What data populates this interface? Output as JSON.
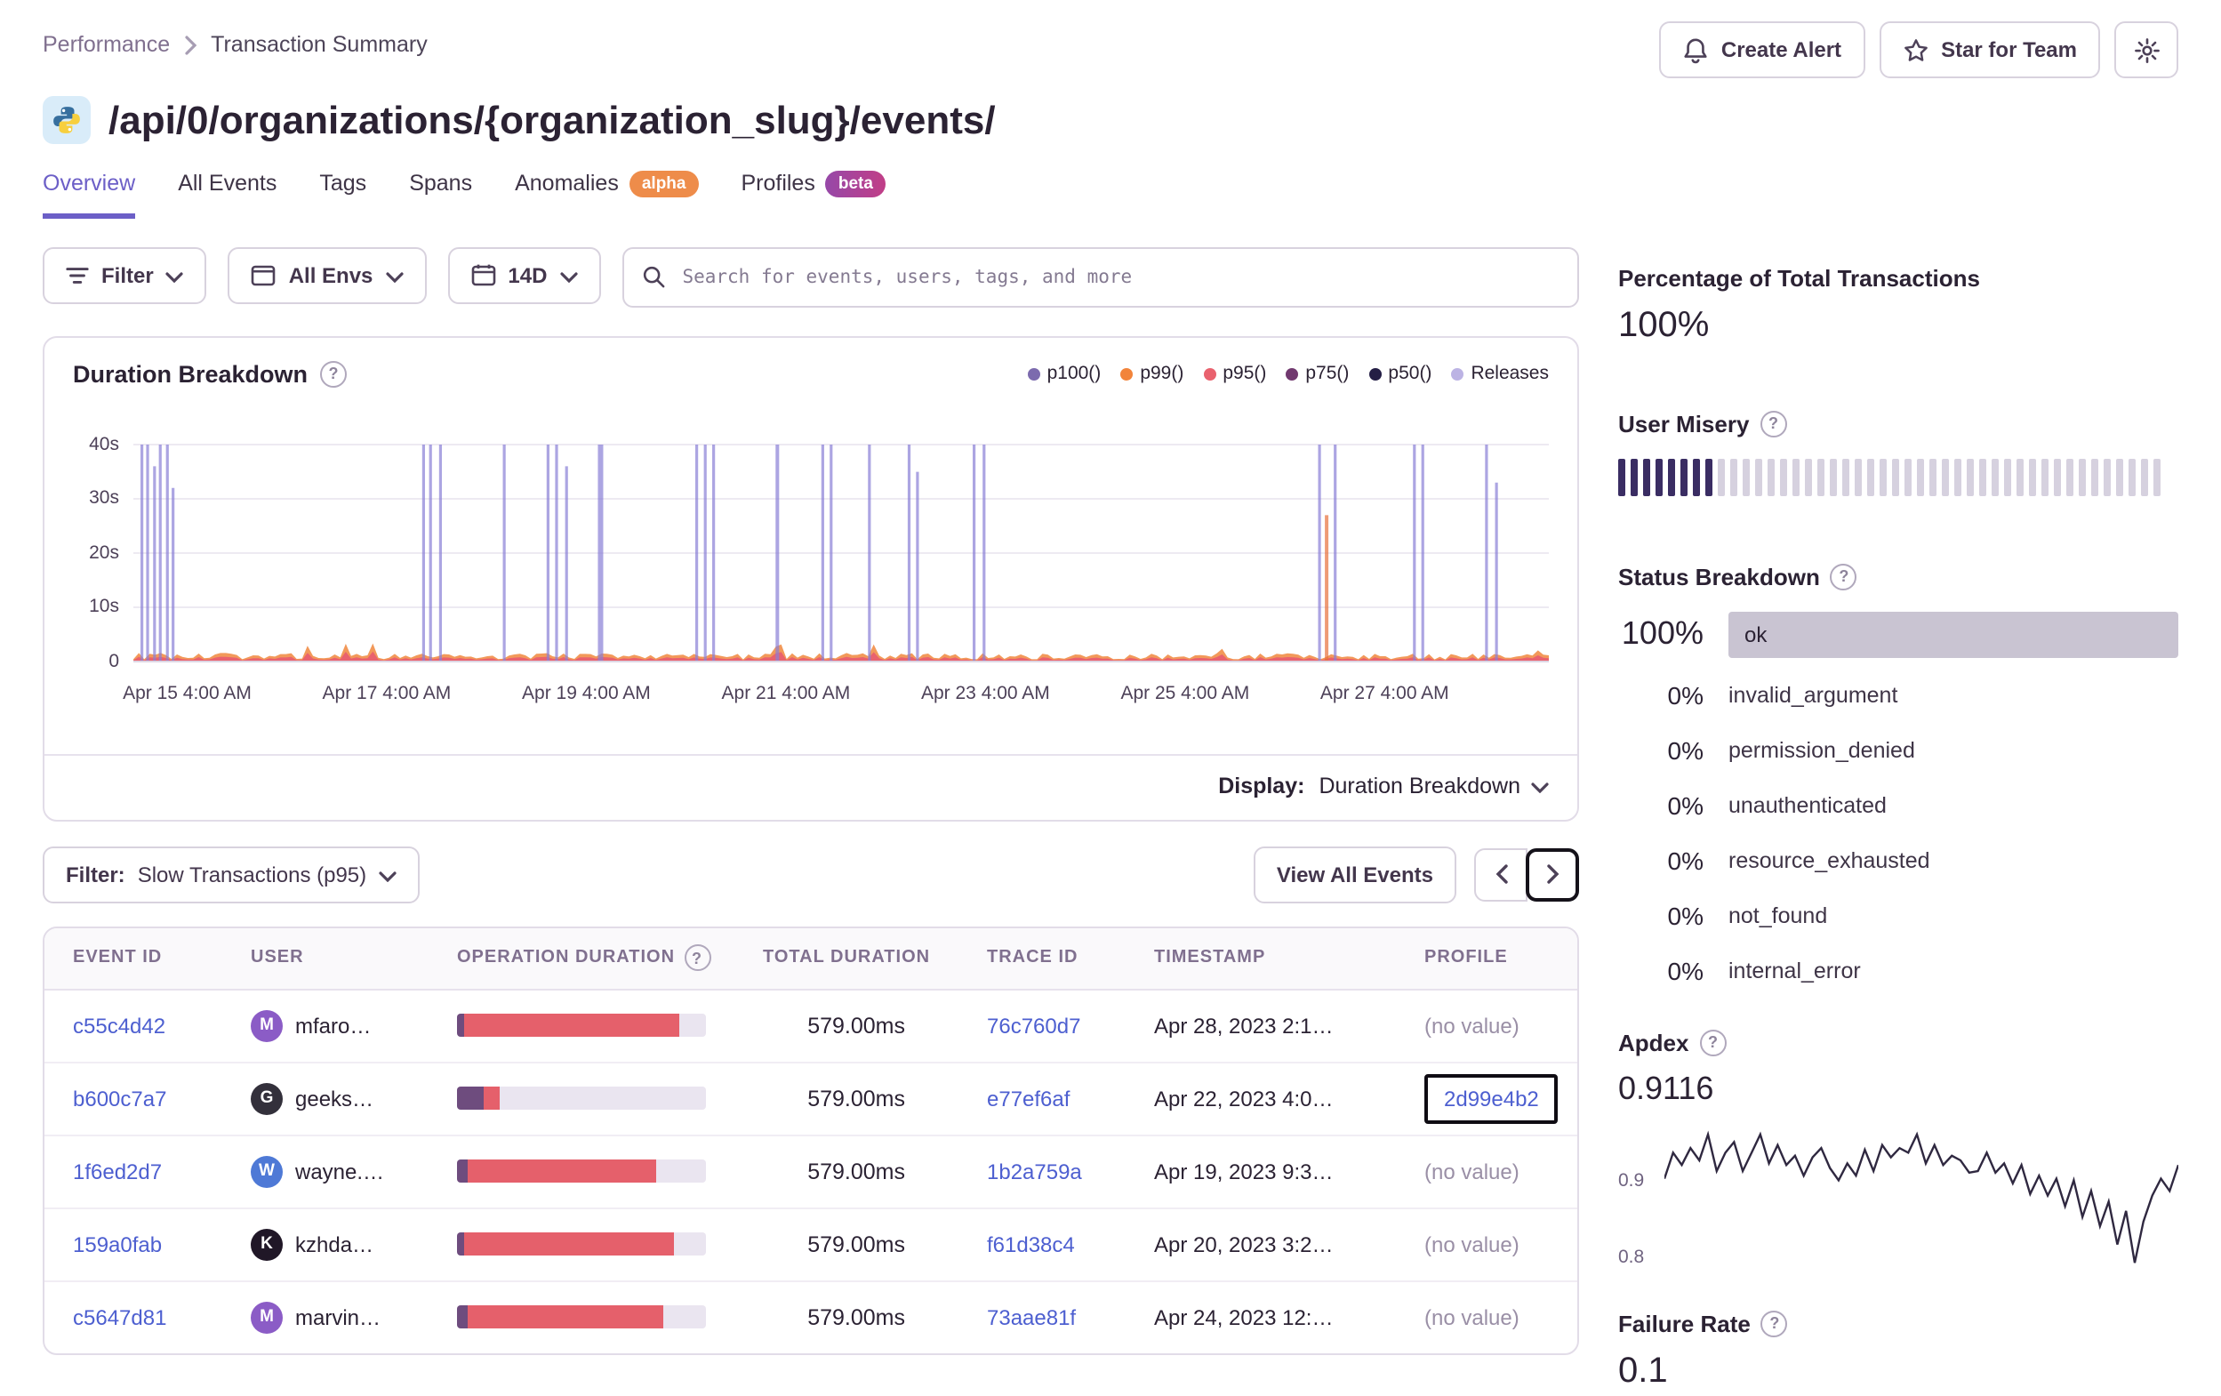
{
  "colors": {
    "accent": "#6C5FC7",
    "link": "#4D5FD0",
    "alpha_badge": "#EE8C4A",
    "beta_badge_start": "#9648A8",
    "beta_badge_end": "#C13E87"
  },
  "breadcrumb": {
    "section": "Performance",
    "page": "Transaction Summary"
  },
  "actions": {
    "create_alert": "Create Alert",
    "star_for_team": "Star for Team"
  },
  "page_title": "/api/0/organizations/{organization_slug}/events/",
  "tabs": [
    {
      "label": "Overview",
      "active": true
    },
    {
      "label": "All Events"
    },
    {
      "label": "Tags"
    },
    {
      "label": "Spans"
    },
    {
      "label": "Anomalies",
      "badge": "alpha",
      "badge_bg": "#EE8C4A"
    },
    {
      "label": "Profiles",
      "badge": "beta",
      "badge_bg": "linear-gradient(90deg,#9648A8,#C13E87)"
    }
  ],
  "filter_bar": {
    "filter_label": "Filter",
    "env_label": "All Envs",
    "date_label": "14D",
    "search_placeholder": "Search for events, users, tags, and more"
  },
  "duration_panel": {
    "title": "Duration Breakdown",
    "display_label": "Display:",
    "display_value": "Duration Breakdown",
    "chart_data": {
      "type": "area",
      "title": "Duration Breakdown",
      "ylim": [
        0,
        40
      ],
      "y_ticks": [
        "40s",
        "30s",
        "20s",
        "10s",
        "0"
      ],
      "x_ticks": [
        "Apr 15 4:00 AM",
        "Apr 17 4:00 AM",
        "Apr 19 4:00 AM",
        "Apr 21 4:00 AM",
        "Apr 23 4:00 AM",
        "Apr 25 4:00 AM",
        "Apr 27 4:00 AM"
      ],
      "series_legend": [
        {
          "label": "p100()",
          "color": "#7C6BAE"
        },
        {
          "label": "p99()",
          "color": "#F2843B"
        },
        {
          "label": "p95()",
          "color": "#E9626E"
        },
        {
          "label": "p75()",
          "color": "#71396F"
        },
        {
          "label": "p50()",
          "color": "#241E45"
        },
        {
          "label": "Releases",
          "color": "#BCB3E4"
        }
      ],
      "baseline_seconds": 1.2,
      "spikes": [
        {
          "x": 0.006,
          "h": 40
        },
        {
          "x": 0.01,
          "h": 40
        },
        {
          "x": 0.015,
          "h": 36
        },
        {
          "x": 0.019,
          "h": 40
        },
        {
          "x": 0.024,
          "h": 40
        },
        {
          "x": 0.028,
          "h": 32
        },
        {
          "x": 0.205,
          "h": 40
        },
        {
          "x": 0.21,
          "h": 40
        },
        {
          "x": 0.217,
          "h": 40
        },
        {
          "x": 0.262,
          "h": 40
        },
        {
          "x": 0.293,
          "h": 40
        },
        {
          "x": 0.299,
          "h": 40
        },
        {
          "x": 0.306,
          "h": 36
        },
        {
          "x": 0.33,
          "h": 40,
          "w": 3
        },
        {
          "x": 0.398,
          "h": 40
        },
        {
          "x": 0.404,
          "h": 40
        },
        {
          "x": 0.41,
          "h": 40
        },
        {
          "x": 0.455,
          "h": 40,
          "w": 2
        },
        {
          "x": 0.487,
          "h": 40
        },
        {
          "x": 0.493,
          "h": 40
        },
        {
          "x": 0.52,
          "h": 40
        },
        {
          "x": 0.548,
          "h": 40
        },
        {
          "x": 0.554,
          "h": 35
        },
        {
          "x": 0.594,
          "h": 40
        },
        {
          "x": 0.601,
          "h": 40
        },
        {
          "x": 0.838,
          "h": 40
        },
        {
          "x": 0.843,
          "h": 27,
          "color": "#E8713B",
          "w": 2
        },
        {
          "x": 0.849,
          "h": 40
        },
        {
          "x": 0.905,
          "h": 40
        },
        {
          "x": 0.911,
          "h": 40
        },
        {
          "x": 0.956,
          "h": 40
        },
        {
          "x": 0.963,
          "h": 33
        }
      ]
    }
  },
  "events_toolbar": {
    "filter_label": "Filter:",
    "filter_value": "Slow Transactions (p95)",
    "view_all": "View All Events"
  },
  "events_table": {
    "columns": [
      "Event ID",
      "User",
      "Operation Duration",
      "Total Duration",
      "Trace ID",
      "Timestamp",
      "Profile"
    ],
    "rows": [
      {
        "event_id": "c55c4d42",
        "user_initial": "M",
        "user_name": "mfaro…",
        "avatar_color": "#8B5CC6",
        "segments": [
          [
            "#6E4C7E",
            0.03
          ],
          [
            "#E5606B",
            0.86
          ]
        ],
        "total": "579.00ms",
        "trace_id": "76c760d7",
        "timestamp": "Apr 28, 2023 2:1…",
        "profile": "(no value)"
      },
      {
        "event_id": "b600c7a7",
        "user_initial": "G",
        "user_name": "geeks…",
        "avatar_color": "#33303B",
        "segments": [
          [
            "#6E4C7E",
            0.11
          ],
          [
            "#E5606B",
            0.06
          ]
        ],
        "total": "579.00ms",
        "trace_id": "e77ef6af",
        "timestamp": "Apr 22, 2023 4:0…",
        "profile": "2d99e4b2",
        "profile_link": true,
        "profile_focused": true
      },
      {
        "event_id": "1f6ed2d7",
        "user_initial": "W",
        "user_name": "wayne.…",
        "avatar_color": "#4E79D6",
        "segments": [
          [
            "#6E4C7E",
            0.04
          ],
          [
            "#E5606B",
            0.76
          ]
        ],
        "total": "579.00ms",
        "trace_id": "1b2a759a",
        "timestamp": "Apr 19, 2023 9:3…",
        "profile": "(no value)"
      },
      {
        "event_id": "159a0fab",
        "user_initial": "K",
        "user_name": "kzhda…",
        "avatar_color": "#201727",
        "segments": [
          [
            "#6E4C7E",
            0.03
          ],
          [
            "#E5606B",
            0.84
          ]
        ],
        "total": "579.00ms",
        "trace_id": "f61d38c4",
        "timestamp": "Apr 20, 2023 3:2…",
        "profile": "(no value)"
      },
      {
        "event_id": "c5647d81",
        "user_initial": "M",
        "user_name": "marvin…",
        "avatar_color": "#8B5CC6",
        "segments": [
          [
            "#6E4C7E",
            0.04
          ],
          [
            "#E5606B",
            0.79
          ]
        ],
        "total": "579.00ms",
        "trace_id": "73aae81f",
        "timestamp": "Apr 24, 2023 12:…",
        "profile": "(no value)"
      }
    ]
  },
  "sidebar": {
    "total_transactions": {
      "label": "Percentage of Total Transactions",
      "value": "100%"
    },
    "user_misery": {
      "label": "User Misery",
      "total_bars": 44,
      "filled_bars": 8,
      "filled_color": "#3A2D63",
      "empty_color": "#D6D1DF"
    },
    "status_breakdown": {
      "label": "Status Breakdown",
      "rows": [
        {
          "pct": "100%",
          "status": "ok",
          "bar": true
        },
        {
          "pct": "0%",
          "status": "invalid_argument"
        },
        {
          "pct": "0%",
          "status": "permission_denied"
        },
        {
          "pct": "0%",
          "status": "unauthenticated"
        },
        {
          "pct": "0%",
          "status": "resource_exhausted"
        },
        {
          "pct": "0%",
          "status": "not_found"
        },
        {
          "pct": "0%",
          "status": "internal_error"
        }
      ]
    },
    "apdex": {
      "label": "Apdex",
      "value": "0.9116",
      "chart_data": {
        "type": "line",
        "ylim": [
          0.78,
          0.98
        ],
        "y_ticks": [
          "0.9",
          "0.8"
        ],
        "values": [
          0.91,
          0.94,
          0.92,
          0.95,
          0.93,
          0.96,
          0.92,
          0.94,
          0.95,
          0.92,
          0.94,
          0.96,
          0.93,
          0.95,
          0.92,
          0.94,
          0.91,
          0.93,
          0.95,
          0.92,
          0.9,
          0.93,
          0.91,
          0.94,
          0.92,
          0.95,
          0.93,
          0.95,
          0.94,
          0.96,
          0.93,
          0.95,
          0.92,
          0.94,
          0.93,
          0.91,
          0.92,
          0.94,
          0.91,
          0.93,
          0.9,
          0.92,
          0.89,
          0.91,
          0.88,
          0.91,
          0.87,
          0.9,
          0.86,
          0.89,
          0.84,
          0.88,
          0.82,
          0.86,
          0.8,
          0.85,
          0.88,
          0.91,
          0.89,
          0.92
        ],
        "line_color": "#2F2840"
      }
    },
    "failure_rate": {
      "label": "Failure Rate",
      "value": "0.1"
    }
  }
}
